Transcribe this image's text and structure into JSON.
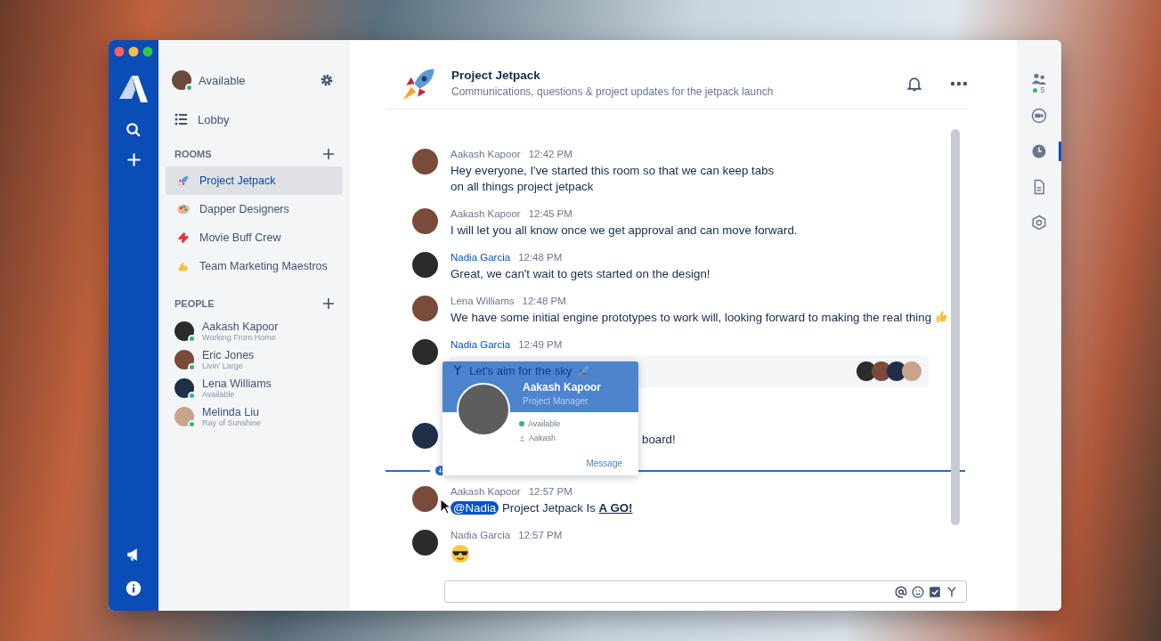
{
  "sidebar": {
    "status": "Available",
    "lobby": "Lobby",
    "rooms_heading": "ROOMS",
    "people_heading": "PEOPLE",
    "rooms": [
      {
        "name": "Project Jetpack",
        "kind": "rocket",
        "selected": true
      },
      {
        "name": "Dapper Designers",
        "kind": "palette",
        "selected": false
      },
      {
        "name": "Movie Buff Crew",
        "kind": "ticket",
        "selected": false
      },
      {
        "name": "Team Marketing Maestros",
        "kind": "muscle",
        "selected": false
      }
    ],
    "people": [
      {
        "name": "Aakash Kapoor",
        "status": "Working From Home",
        "online": true
      },
      {
        "name": "Eric Jones",
        "status": "Livin' Large",
        "online": true
      },
      {
        "name": "Lena Williams",
        "status": "Available",
        "online": true
      },
      {
        "name": "Melinda Liu",
        "status": "Ray of Sunshine",
        "online": true
      }
    ]
  },
  "channel": {
    "title": "Project Jetpack",
    "description": "Communications, questions & project updates for the jetpack launch"
  },
  "right_rail": {
    "member_count": "5",
    "items": [
      {
        "kind": "video",
        "selected": false
      },
      {
        "kind": "clock",
        "selected": true
      },
      {
        "kind": "document",
        "selected": false
      },
      {
        "kind": "hexagon",
        "selected": false
      }
    ]
  },
  "messages": [
    {
      "author": "Aakash Kapoor",
      "time": "12:42 PM",
      "highlighted": false,
      "kind": "text",
      "text": "Hey everyone, I've started this room so that we can keep tabs\non all things project jetpack"
    },
    {
      "author": "Aakash Kapoor",
      "time": "12:45 PM",
      "highlighted": false,
      "kind": "text",
      "text": "I will let you all know once we get approval and can move forward."
    },
    {
      "author": "Nadia Garcia",
      "time": "12:48 PM",
      "highlighted": true,
      "kind": "text",
      "text": "Great, we can't wait to gets started on the design!"
    },
    {
      "author": "Lena Williams",
      "time": "12:48 PM",
      "highlighted": false,
      "kind": "text",
      "text": "We have some initial engine prototypes to work will, looking forward to making the real thing",
      "thumbs_up": true
    },
    {
      "author": "Nadia Garcia",
      "time": "12:49 PM",
      "highlighted": true,
      "kind": "quote",
      "text": "Let's aim for the sky",
      "popover": {
        "name": "Aakash Kapoor",
        "role": "Project Manager",
        "status": "Available",
        "username": "Aakash",
        "action": "Message"
      }
    },
    {
      "kind": "covered",
      "text": "board!"
    },
    {
      "kind": "divider"
    },
    {
      "author": "Aakash Kapoor",
      "time": "12:57 PM",
      "highlighted": false,
      "kind": "mention",
      "mention": "@Nadia",
      "text": " Project Jetpack Is **A GO!**"
    },
    {
      "author": "Nadia Garcia",
      "time": "12:57 PM",
      "highlighted": false,
      "kind": "emoji"
    }
  ]
}
